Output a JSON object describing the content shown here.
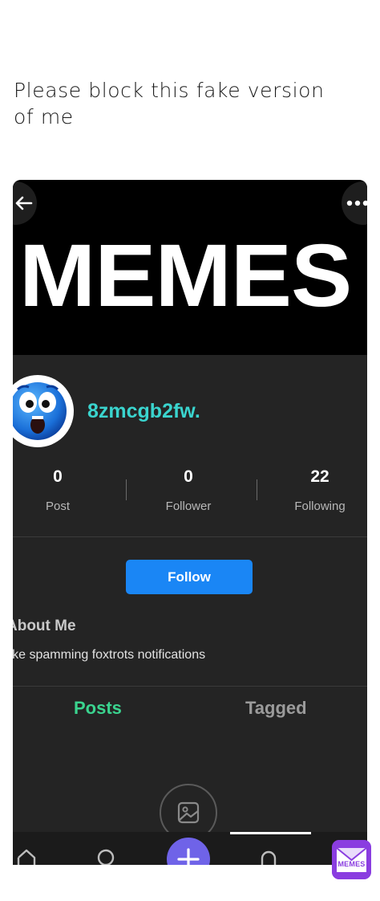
{
  "caption": "Please block this fake version of me",
  "profile": {
    "banner_text": "MEMES",
    "username": "8zmcgb2fw.",
    "stats": [
      {
        "value": "0",
        "label": "Post"
      },
      {
        "value": "0",
        "label": "Follower"
      },
      {
        "value": "22",
        "label": "Following"
      }
    ],
    "follow_label": "Follow",
    "about_title": "About Me",
    "about_text": "like spamming foxtrots notifications",
    "tabs": [
      {
        "label": "Posts",
        "active": true
      },
      {
        "label": "Tagged",
        "active": false
      }
    ]
  },
  "icons": {
    "back": "back-arrow-icon",
    "more": "more-icon",
    "avatar": "shocked-emoji-icon",
    "empty": "image-icon",
    "nav": [
      "home-icon",
      "search-icon",
      "add-icon",
      "bell-icon"
    ]
  },
  "colors": {
    "username": "#3ad4ce",
    "posts_tab": "#3ad48f",
    "follow_button": "#1a86f5",
    "add_button": "#6f63e8"
  },
  "watermark": {
    "text": "MEMES"
  }
}
